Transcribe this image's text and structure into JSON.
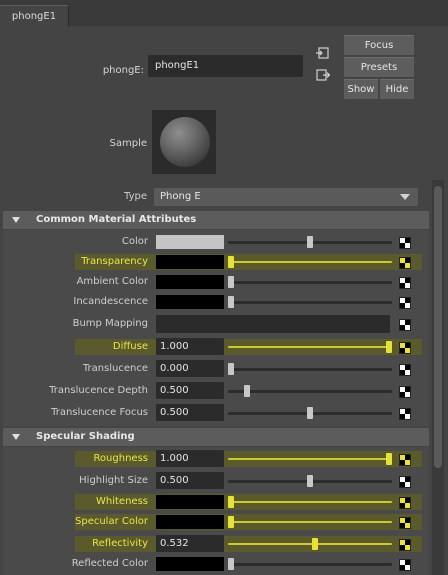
{
  "tab": {
    "label": "phongE1"
  },
  "node": {
    "label": "phongE:",
    "value": "phongE1"
  },
  "buttons": {
    "focus": "Focus",
    "presets": "Presets",
    "show": "Show",
    "hide": "Hide"
  },
  "sample": {
    "label": "Sample"
  },
  "type": {
    "label": "Type",
    "value": "Phong E"
  },
  "sections": [
    {
      "title": "Common Material Attributes"
    },
    {
      "title": "Specular Shading"
    }
  ],
  "common_rows": [
    {
      "label": "Color",
      "kind": "swatch",
      "swatch": "#c4c4c4",
      "slider": 0.5,
      "highlight": false
    },
    {
      "label": "Transparency",
      "kind": "swatch",
      "swatch": "#000000",
      "slider": 0.0,
      "highlight": true
    },
    {
      "label": "Ambient Color",
      "kind": "swatch",
      "swatch": "#000000",
      "slider": 0.0,
      "highlight": false
    },
    {
      "label": "Incandescence",
      "kind": "swatch",
      "swatch": "#000000",
      "slider": 0.0,
      "highlight": false
    },
    {
      "label": "Bump Mapping",
      "kind": "bump",
      "highlight": false
    },
    {
      "label": "Diffuse",
      "kind": "number",
      "value": "1.000",
      "slider": 1.0,
      "highlight": true
    },
    {
      "label": "Translucence",
      "kind": "number",
      "value": "0.000",
      "slider": 0.0,
      "highlight": false
    },
    {
      "label": "Translucence Depth",
      "kind": "number",
      "value": "0.500",
      "slider": 0.1,
      "highlight": false
    },
    {
      "label": "Translucence Focus",
      "kind": "number",
      "value": "0.500",
      "slider": 0.5,
      "highlight": false
    }
  ],
  "specular_rows": [
    {
      "label": "Roughness",
      "kind": "number",
      "value": "1.000",
      "slider": 1.0,
      "highlight": true
    },
    {
      "label": "Highlight Size",
      "kind": "number",
      "value": "0.500",
      "slider": 0.5,
      "highlight": false
    },
    {
      "label": "Whiteness",
      "kind": "swatch",
      "swatch": "#000000",
      "slider": 0.0,
      "highlight": true
    },
    {
      "label": "Specular Color",
      "kind": "swatch",
      "swatch": "#000000",
      "slider": 0.0,
      "highlight": true
    },
    {
      "label": "Reflectivity",
      "kind": "number",
      "value": "0.532",
      "slider": 0.532,
      "highlight": true
    },
    {
      "label": "Reflected Color",
      "kind": "swatch",
      "swatch": "#000000",
      "slider": 0.0,
      "highlight": false
    }
  ],
  "colors": {
    "highlight": "#5a5a2c",
    "accent_yellow": "#e9e64a"
  }
}
